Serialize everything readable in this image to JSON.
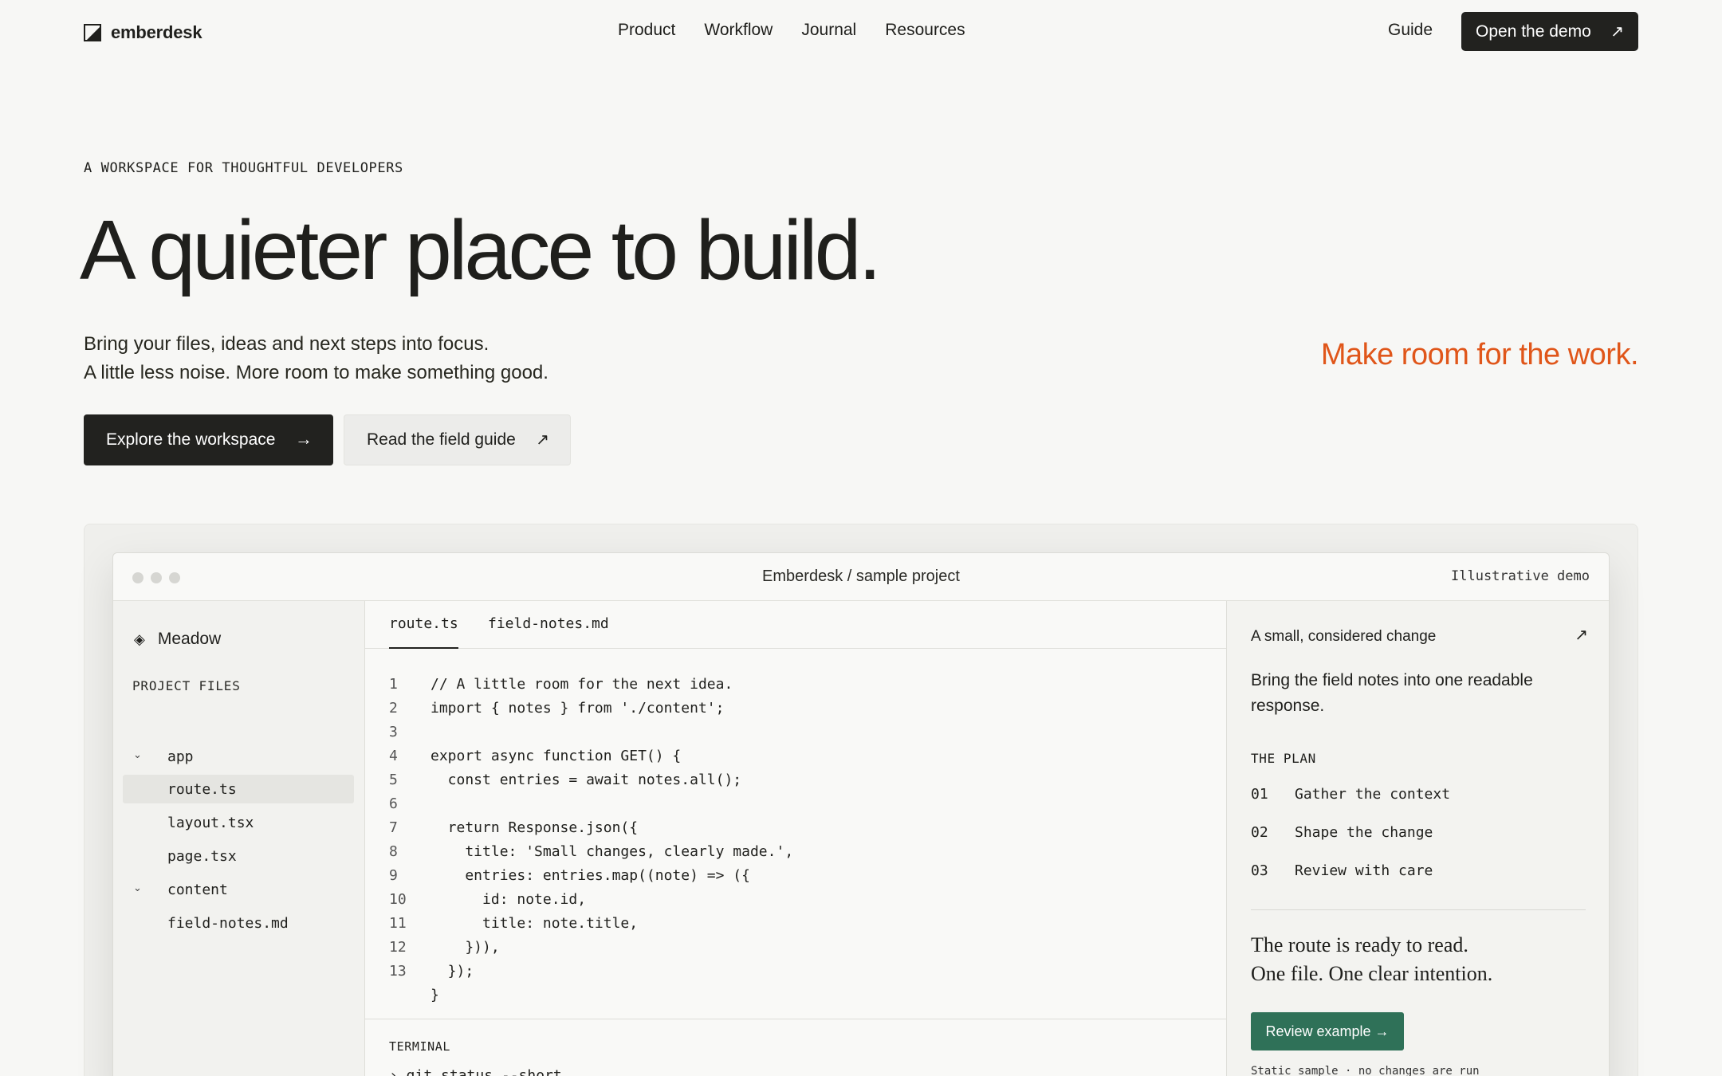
{
  "nav": {
    "brand": "emberdesk",
    "links": [
      "Product",
      "Workflow",
      "Journal",
      "Resources"
    ],
    "guide": "Guide",
    "cta": "Open the demo",
    "cta_icon": "arrow-up-right-icon"
  },
  "hero": {
    "eyebrow": "A WORKSPACE FOR THOUGHTFUL DEVELOPERS",
    "headline": "A quieter place to build.",
    "sub_line1": "Bring your files, ideas and next steps into focus.",
    "sub_line2": "A little less noise. More room to make something good.",
    "accent": "Make room for the work.",
    "accent_color": "#e0561a",
    "primary_button": "Explore the workspace",
    "secondary_button": "Read the field guide"
  },
  "window": {
    "title": "Emberdesk / sample project",
    "badge": "Illustrative demo",
    "sidebar": {
      "project": "Meadow",
      "files_label": "PROJECT FILES",
      "tree": [
        {
          "name": "app",
          "folder": true
        },
        {
          "name": "route.ts",
          "folder": false,
          "active": true
        },
        {
          "name": "layout.tsx",
          "folder": false
        },
        {
          "name": "page.tsx",
          "folder": false
        },
        {
          "name": "content",
          "folder": true
        },
        {
          "name": "field-notes.md",
          "folder": false
        }
      ]
    },
    "editor": {
      "tabs": [
        "route.ts",
        "field-notes.md"
      ],
      "active_tab": "route.ts",
      "lines": [
        {
          "n": "1",
          "t": "// A little room for the next idea."
        },
        {
          "n": "2",
          "t": "import { notes } from './content';"
        },
        {
          "n": "3",
          "t": ""
        },
        {
          "n": "4",
          "t": "export async function GET() {"
        },
        {
          "n": "5",
          "t": "  const entries = await notes.all();"
        },
        {
          "n": "6",
          "t": ""
        },
        {
          "n": "7",
          "t": "  return Response.json({"
        },
        {
          "n": "8",
          "t": "    title: 'Small changes, clearly made.',"
        },
        {
          "n": "9",
          "t": "    entries: entries.map((note) => ({"
        },
        {
          "n": "10",
          "t": "      id: note.id,"
        },
        {
          "n": "11",
          "t": "      title: note.title,"
        },
        {
          "n": "12",
          "t": "    })),"
        },
        {
          "n": "13",
          "t": "  });"
        },
        {
          "n": "",
          "t": "}"
        }
      ],
      "terminal_label": "TERMINAL",
      "terminal_cmd": "› git status --short"
    },
    "panel": {
      "title": "A small, considered change",
      "description": "Bring the field notes into one readable response.",
      "plan_label": "THE PLAN",
      "steps": [
        {
          "num": "01",
          "text": "Gather the context"
        },
        {
          "num": "02",
          "text": "Shape the change"
        },
        {
          "num": "03",
          "text": "Review with care"
        }
      ],
      "summary_line1": "The route is ready to read.",
      "summary_line2": "One file. One clear intention.",
      "review_button": "Review example →",
      "review_color": "#2f7158",
      "footnote": "Static sample · no changes are run"
    }
  }
}
